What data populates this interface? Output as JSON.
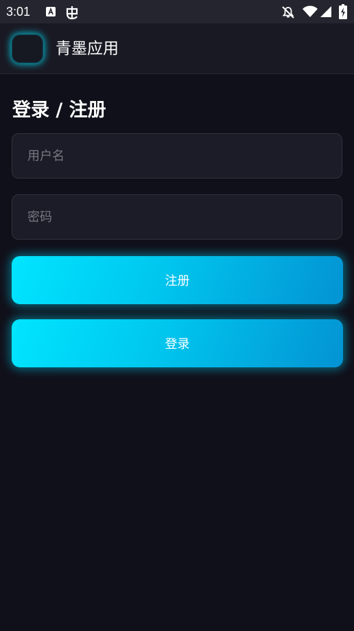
{
  "status_bar": {
    "time": "3:01",
    "icons": [
      "a-notification-icon",
      "bug-notification-icon",
      "notifications-off-icon",
      "wifi-icon",
      "cell-signal-icon",
      "battery-charging-icon"
    ]
  },
  "app_bar": {
    "title": "青墨应用"
  },
  "page": {
    "heading": "登录 / 注册"
  },
  "form": {
    "username": {
      "value": "",
      "placeholder": "用户名"
    },
    "password": {
      "value": "",
      "placeholder": "密码"
    },
    "register_label": "注册",
    "login_label": "登录"
  },
  "colors": {
    "background": "#10101a",
    "accent_start": "#00e5ff",
    "accent_end": "#0393d3"
  }
}
